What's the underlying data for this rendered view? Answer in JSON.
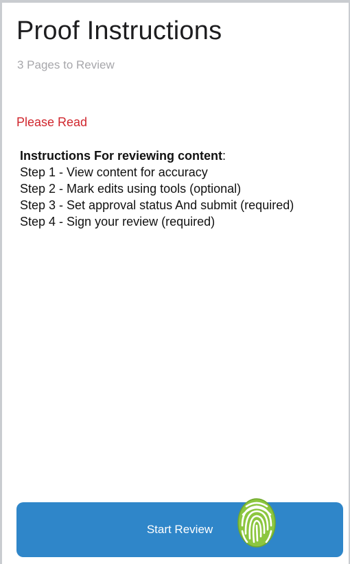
{
  "header": {
    "title": "Proof Instructions",
    "subtitle": "3 Pages to Review"
  },
  "notice": {
    "text": "Please Read"
  },
  "instructions": {
    "heading": "Instructions For reviewing content",
    "heading_suffix": ":",
    "steps": [
      "Step 1 - View content for accuracy",
      "Step 2 - Mark edits using tools (optional)",
      "Step 3 - Set approval status And submit (required)",
      "Step 4 - Sign your review (required)"
    ]
  },
  "actions": {
    "start_label": "Start Review",
    "fingerprint_icon": "fingerprint-icon"
  },
  "colors": {
    "accent": "#2f86c9",
    "notice": "#d0262d",
    "muted": "#a7a7ab",
    "fingerprint": "#8cc63f"
  }
}
